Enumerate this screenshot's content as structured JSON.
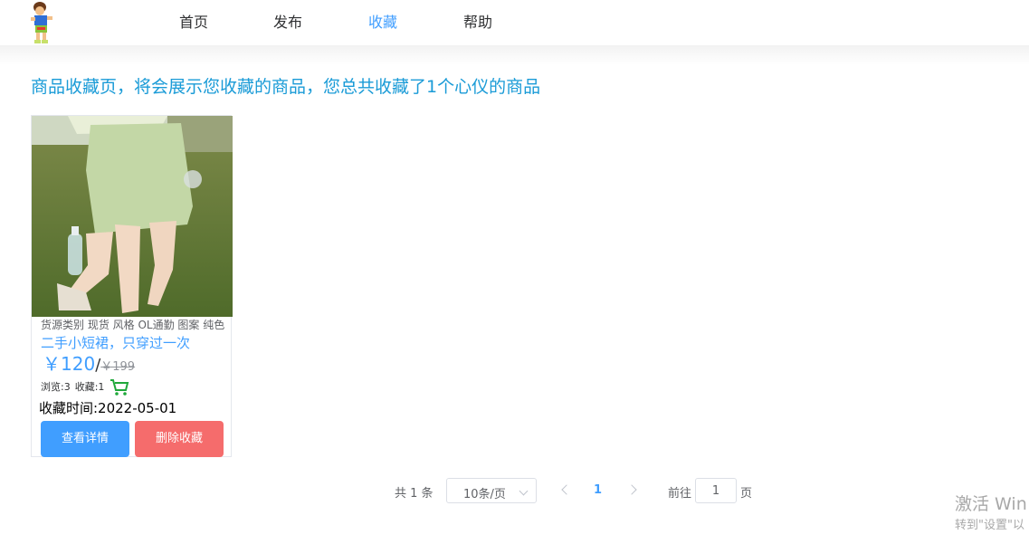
{
  "nav": {
    "items": [
      {
        "label": "首页",
        "active": false
      },
      {
        "label": "发布",
        "active": false
      },
      {
        "label": "收藏",
        "active": true
      },
      {
        "label": "帮助",
        "active": false
      }
    ]
  },
  "page": {
    "title": "商品收藏页，将会展示您收藏的商品，您总共收藏了1个心仪的商品"
  },
  "products": [
    {
      "description": "货源类别 现货 风格 OL通勤 图案 纯色",
      "name": "二手小短裙，只穿过一次",
      "price": "￥120",
      "slash": "/",
      "original_price": "￥199",
      "views": "浏览:3",
      "favorites": "收藏:1",
      "favorite_time": "收藏时间:2022-05-01",
      "view_button": "查看详情",
      "delete_button": "删除收藏"
    }
  ],
  "pagination": {
    "total": "共 1 条",
    "page_size": "10条/页",
    "current_page": "1",
    "goto_label": "前往",
    "goto_value": "1",
    "page_suffix": "页"
  },
  "watermark": {
    "line1": "激活 Win",
    "line2": "转到\"设置\"以"
  },
  "colors": {
    "accent": "#409EFF",
    "danger": "#F56C6C",
    "title": "#1a9bd7"
  },
  "icons": [
    "avatar-logo-icon",
    "shopping-cart-icon",
    "chevron-down-icon",
    "chevron-left-icon",
    "chevron-right-icon"
  ]
}
